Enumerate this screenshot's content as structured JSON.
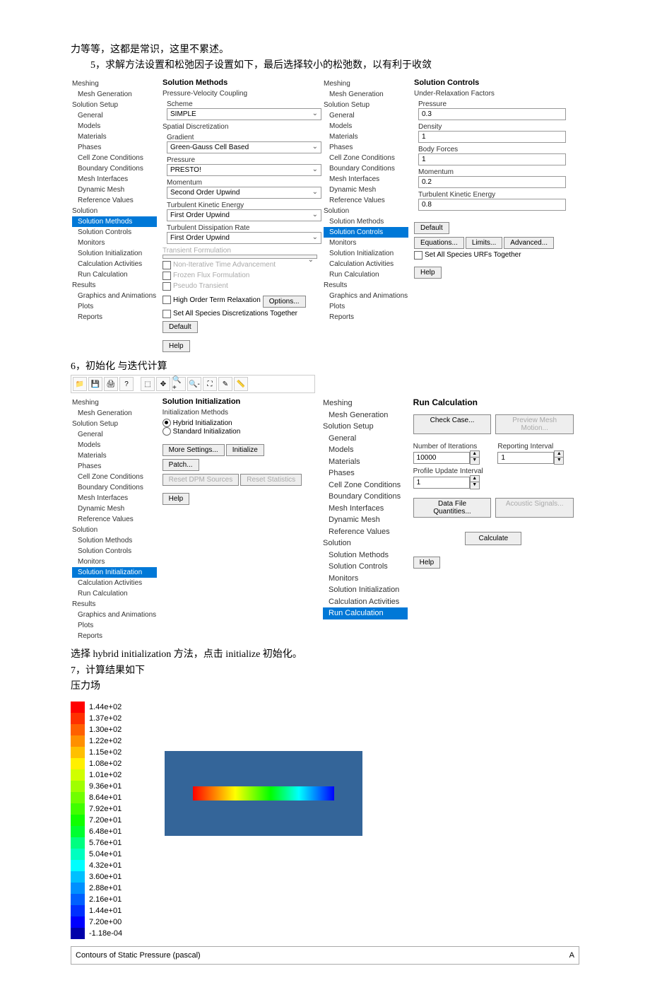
{
  "doc_text": {
    "intro": "力等等，这都是常识，这里不累述。",
    "step5": "5，求解方法设置和松弛因子设置如下，最后选择较小的松弛数，以有利于收敛",
    "step6": "6，初始化 与迭代计算",
    "step6b": "选择 hybrid initialization 方法，点击 initialize 初始化。",
    "step7": "7，计算结果如下",
    "step7b": "压力场"
  },
  "tree": {
    "meshing": "Meshing",
    "mesh_gen": "Mesh Generation",
    "solution_setup": "Solution Setup",
    "general": "General",
    "models": "Models",
    "materials": "Materials",
    "phases": "Phases",
    "czc": "Cell Zone Conditions",
    "bc": "Boundary Conditions",
    "mi": "Mesh Interfaces",
    "dm": "Dynamic Mesh",
    "rv": "Reference Values",
    "solution": "Solution",
    "sm": "Solution Methods",
    "sc": "Solution Controls",
    "mon": "Monitors",
    "si": "Solution Initialization",
    "ca": "Calculation Activities",
    "rc": "Run Calculation",
    "results": "Results",
    "ga": "Graphics and Animations",
    "plots": "Plots",
    "reports": "Reports"
  },
  "solution_methods": {
    "heading": "Solution Methods",
    "pvc": "Pressure-Velocity Coupling",
    "scheme_label": "Scheme",
    "scheme_val": "SIMPLE",
    "sd": "Spatial Discretization",
    "gradient": "Gradient",
    "gradient_val": "Green-Gauss Cell Based",
    "pressure": "Pressure",
    "pressure_val": "PRESTO!",
    "momentum": "Momentum",
    "momentum_val": "Second Order Upwind",
    "tke": "Turbulent Kinetic Energy",
    "tke_val": "First Order Upwind",
    "tdr": "Turbulent Dissipation Rate",
    "tdr_val": "First Order Upwind",
    "tf": "Transient Formulation",
    "nita": "Non-Iterative Time Advancement",
    "ffx": "Frozen Flux Formulation",
    "pt": "Pseudo Transient",
    "hotr": "High Order Term Relaxation",
    "options": "Options...",
    "sasdt": "Set All Species Discretizations Together",
    "default": "Default",
    "help": "Help"
  },
  "solution_controls": {
    "heading": "Solution Controls",
    "urf": "Under-Relaxation Factors",
    "pressure": "Pressure",
    "pressure_val": "0.3",
    "density": "Density",
    "density_val": "1",
    "bf": "Body Forces",
    "bf_val": "1",
    "momentum": "Momentum",
    "momentum_val": "0.2",
    "tke": "Turbulent Kinetic Energy",
    "tke_val": "0.8",
    "default": "Default",
    "eq": "Equations...",
    "lim": "Limits...",
    "adv": "Advanced...",
    "sasut": "Set All Species URFs Together",
    "help": "Help"
  },
  "solution_init": {
    "heading": "Solution Initialization",
    "im": "Initialization Methods",
    "hybrid": "Hybrid Initialization",
    "standard": "Standard Initialization",
    "more": "More Settings...",
    "init": "Initialize",
    "patch": "Patch...",
    "rds": "Reset DPM Sources",
    "rs": "Reset Statistics",
    "help": "Help"
  },
  "run_calc": {
    "heading": "Run Calculation",
    "check": "Check Case...",
    "preview": "Preview Mesh Motion...",
    "noi": "Number of Iterations",
    "noi_val": "10000",
    "ri": "Reporting Interval",
    "ri_val": "1",
    "pui": "Profile Update Interval",
    "pui_val": "1",
    "dfq": "Data File Quantities...",
    "as": "Acoustic Signals...",
    "calc": "Calculate",
    "help": "Help"
  },
  "toolbar_icons": [
    "open-icon",
    "save-icon",
    "print-icon",
    "help-icon",
    "select-icon",
    "move-icon",
    "zoom-in-icon",
    "zoom-out-icon",
    "fit-icon",
    "probe-icon",
    "ruler-icon"
  ],
  "legend": {
    "values": [
      "1.44e+02",
      "1.37e+02",
      "1.30e+02",
      "1.22e+02",
      "1.15e+02",
      "1.08e+02",
      "1.01e+02",
      "9.36e+01",
      "8.64e+01",
      "7.92e+01",
      "7.20e+01",
      "6.48e+01",
      "5.76e+01",
      "5.04e+01",
      "4.32e+01",
      "3.60e+01",
      "2.88e+01",
      "2.16e+01",
      "1.44e+01",
      "7.20e+00",
      "-1.18e-04"
    ],
    "colors": [
      "#ff0000",
      "#ff3000",
      "#ff6000",
      "#ff9000",
      "#ffc000",
      "#fff000",
      "#d0ff00",
      "#a0ff00",
      "#70ff00",
      "#40ff00",
      "#10ff00",
      "#00ff30",
      "#00ff80",
      "#00ffc0",
      "#00ffff",
      "#00c0ff",
      "#0090ff",
      "#0060ff",
      "#0030ff",
      "#0000ff",
      "#0000aa"
    ]
  },
  "contour_title": "Contours of Static Pressure (pascal)",
  "contour_letter": "A"
}
